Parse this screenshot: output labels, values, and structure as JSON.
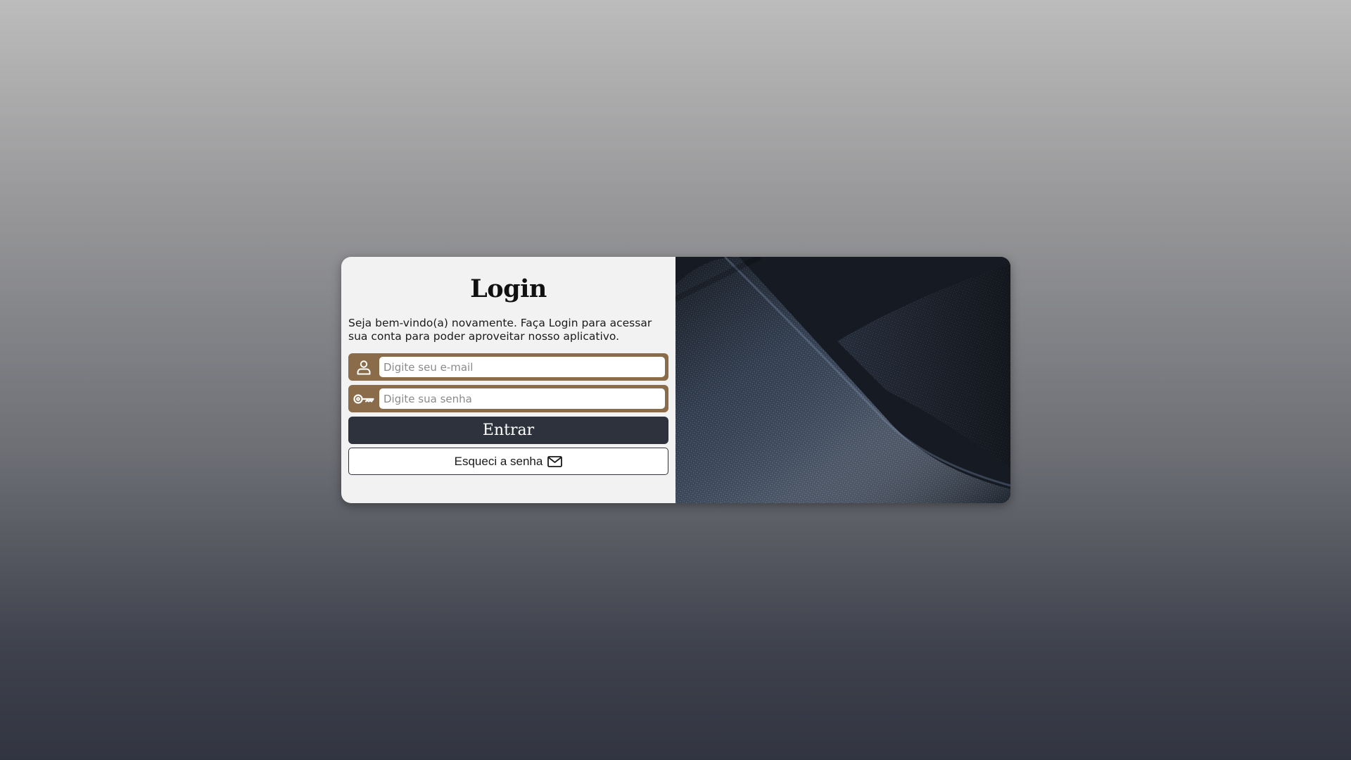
{
  "login": {
    "title": "Login",
    "subtitle": "Seja bem-vindo(a) novamente. Faça Login para acessar sua conta para poder aproveitar nosso aplicativo.",
    "email_placeholder": "Digite seu e-mail",
    "password_placeholder": "Digite sua senha",
    "submit_label": "Entrar",
    "forgot_label": "Esqueci a senha"
  },
  "icons": {
    "email_field": "user-icon",
    "password_field": "key-icon",
    "forgot": "mail-icon"
  },
  "colors": {
    "field_frame": "#8b6c4a",
    "primary_button": "#2d323c",
    "panel_background": "#f2f2f2"
  }
}
